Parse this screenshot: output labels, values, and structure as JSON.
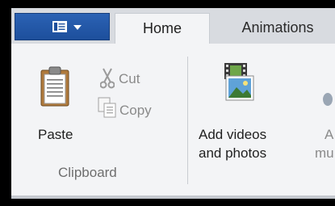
{
  "tabs": {
    "file_menu_icon": "menu-icon",
    "home_label": "Home",
    "animations_label": "Animations"
  },
  "clipboard": {
    "paste_label": "Paste",
    "cut_label": "Cut",
    "copy_label": "Copy",
    "group_label": "Clipboard"
  },
  "add": {
    "add_media_line1": "Add videos",
    "add_media_line2": "and photos",
    "partial_line1": "A",
    "partial_line2": "mu"
  },
  "colors": {
    "file_button": "#1d4f9c",
    "ribbon_bg": "#f3f4f6",
    "tabstrip_bg": "#d8dbe0"
  }
}
